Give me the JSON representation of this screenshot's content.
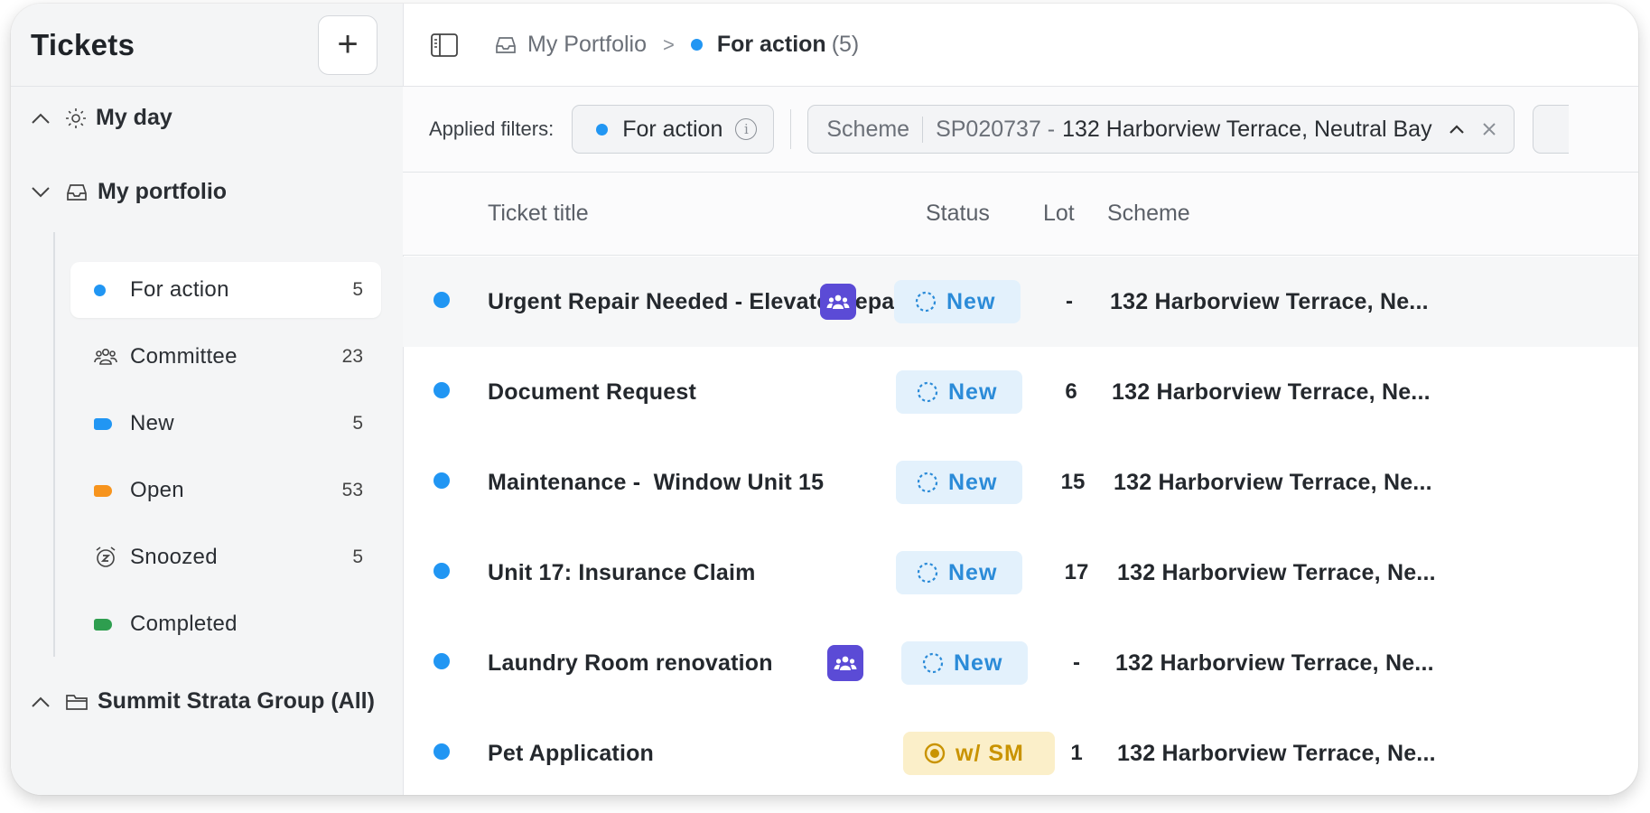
{
  "sidebar": {
    "title": "Tickets",
    "add_label": "+",
    "groups": {
      "my_day": "My day",
      "my_portfolio": "My portfolio",
      "summit": "Summit Strata Group (All)"
    },
    "items": [
      {
        "label": "For action",
        "count": "5",
        "color": "#2196f3"
      },
      {
        "label": "Committee",
        "count": "23"
      },
      {
        "label": "New",
        "count": "5",
        "color": "#2196f3"
      },
      {
        "label": "Open",
        "count": "53",
        "color": "#f7941d"
      },
      {
        "label": "Snoozed",
        "count": "5"
      },
      {
        "label": "Completed",
        "count": "",
        "color": "#2e9e4f"
      }
    ]
  },
  "topbar": {
    "crumb": "My Portfolio",
    "separator": ">",
    "current": "For action",
    "count": "(5)"
  },
  "filters": {
    "label": "Applied filters:",
    "chip1": "For action",
    "info": "i",
    "scheme_key": "Scheme",
    "scheme_code": "SP020737 -",
    "scheme_value": "132 Harborview Terrace, Neutral Bay"
  },
  "table": {
    "headers": {
      "title": "Ticket title",
      "status": "Status",
      "lot": "Lot",
      "scheme": "Scheme"
    },
    "rows": [
      {
        "title": "Urgent Repair Needed - Elevator repair",
        "status": "New",
        "lot": "-",
        "scheme": "132 Harborview Terrace, Ne..."
      },
      {
        "title": "Document Request",
        "status": "New",
        "lot": "6",
        "scheme": "132 Harborview Terrace, Ne..."
      },
      {
        "title": "Maintenance -  Window Unit 15",
        "status": "New",
        "lot": "15",
        "scheme": "132 Harborview Terrace, Ne..."
      },
      {
        "title": "Unit 17: Insurance Claim",
        "status": "New",
        "lot": "17",
        "scheme": "132 Harborview Terrace, Ne..."
      },
      {
        "title": "Laundry Room renovation",
        "status": "New",
        "lot": "-",
        "scheme": "132 Harborview Terrace, Ne..."
      },
      {
        "title": "Pet Application",
        "status": "w/ SM",
        "lot": "1",
        "scheme": "132 Harborview Terrace, Ne..."
      }
    ]
  },
  "colors": {
    "accent": "#2196f3",
    "team": "#5b4bd6",
    "new_bg": "#e3f1fc",
    "sm_bg": "#fbefc9"
  }
}
